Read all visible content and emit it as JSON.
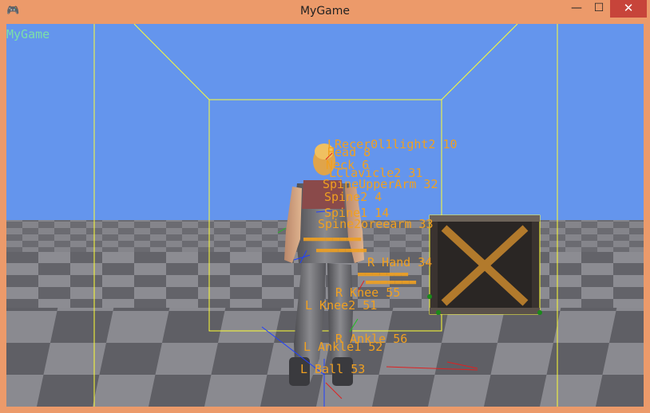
{
  "window": {
    "title": "MyGame",
    "minimize_glyph": "—",
    "maximize_glyph": "☐",
    "close_glyph": "✕",
    "app_icon": "gamepad-icon"
  },
  "viewport": {
    "overlay_label": "MyGame",
    "colors": {
      "sky": "#6495ed",
      "floor_dark": "#5f5f65",
      "floor_light": "#8a8a90",
      "wireframe": "#ffff33",
      "bone_label": "#f0a020",
      "overlay_text": "#7de0a6"
    }
  },
  "bone_labels": [
    "LRecer0l1light2 10",
    "Head 8",
    "Neck 6",
    "LClavicle2 31",
    "SpineUpperArm 32",
    "Spine2 4",
    "Spine1 14",
    "Spine2oreearm 33",
    "R Hand 34",
    "R Knee 55",
    "L Knee2 51",
    "R Ankle 56",
    "L Ankle1 52",
    "L Ball 53"
  ]
}
